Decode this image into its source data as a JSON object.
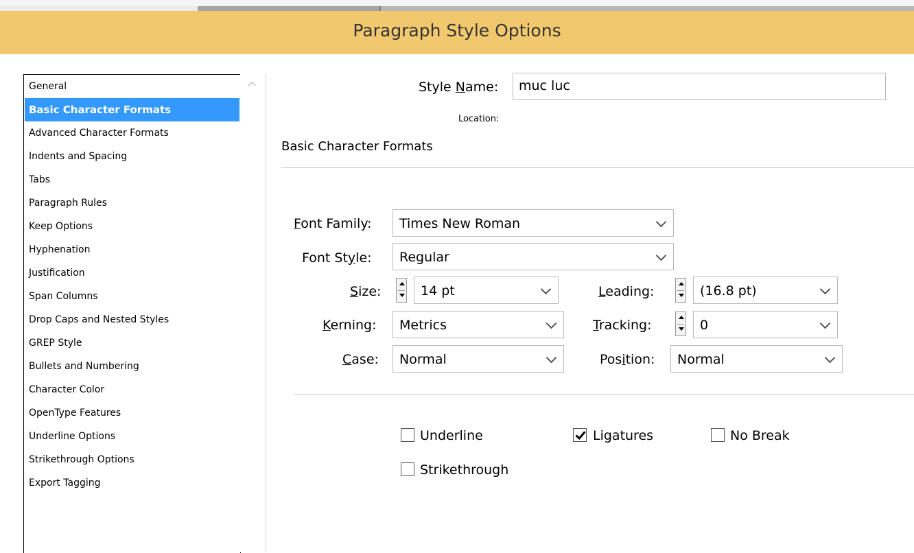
{
  "dialog": {
    "title": "Paragraph Style Options"
  },
  "sidebar": {
    "items": [
      {
        "label": "General"
      },
      {
        "label": "Basic Character Formats",
        "selected": true
      },
      {
        "label": "Advanced Character Formats"
      },
      {
        "label": "Indents and Spacing"
      },
      {
        "label": "Tabs"
      },
      {
        "label": "Paragraph Rules"
      },
      {
        "label": "Keep Options"
      },
      {
        "label": "Hyphenation"
      },
      {
        "label": "Justification"
      },
      {
        "label": "Span Columns"
      },
      {
        "label": "Drop Caps and Nested Styles"
      },
      {
        "label": "GREP Style"
      },
      {
        "label": "Bullets and Numbering"
      },
      {
        "label": "Character Color"
      },
      {
        "label": "OpenType Features"
      },
      {
        "label": "Underline Options"
      },
      {
        "label": "Strikethrough Options"
      },
      {
        "label": "Export Tagging"
      }
    ]
  },
  "style_name": {
    "label_pre": "Style ",
    "label_mnemonic": "N",
    "label_post": "ame:",
    "value": "muc luc"
  },
  "location": {
    "label": "Location:"
  },
  "section": {
    "title": "Basic Character Formats"
  },
  "font_family": {
    "label_mnemonic": "F",
    "label_post": "ont Family:",
    "value": "Times New Roman"
  },
  "font_style": {
    "label_pre": "Font St",
    "label_mnemonic": "y",
    "label_post": "le:",
    "value": "Regular"
  },
  "size": {
    "label_mnemonic": "S",
    "label_post": "ize:",
    "value": "14 pt"
  },
  "leading": {
    "label_mnemonic": "L",
    "label_post": "eading:",
    "value": "(16.8 pt)"
  },
  "kerning": {
    "label_mnemonic": "K",
    "label_post": "erning:",
    "value": "Metrics"
  },
  "tracking": {
    "label_mnemonic": "T",
    "label_post": "racking:",
    "value": "0"
  },
  "case": {
    "label_mnemonic": "C",
    "label_post": "ase:",
    "value": "Normal"
  },
  "position": {
    "label_pre": "Pos",
    "label_mnemonic": "i",
    "label_post": "tion:",
    "value": "Normal"
  },
  "checkboxes": {
    "underline": {
      "label": "Underline",
      "checked": false
    },
    "ligatures": {
      "label": "Ligatures",
      "checked": true
    },
    "no_break": {
      "label": "No Break",
      "checked": false
    },
    "strikethrough": {
      "label": "Strikethrough",
      "checked": false
    }
  },
  "colors": {
    "title_bar": "#f2c86e",
    "selection": "#3399ff"
  }
}
